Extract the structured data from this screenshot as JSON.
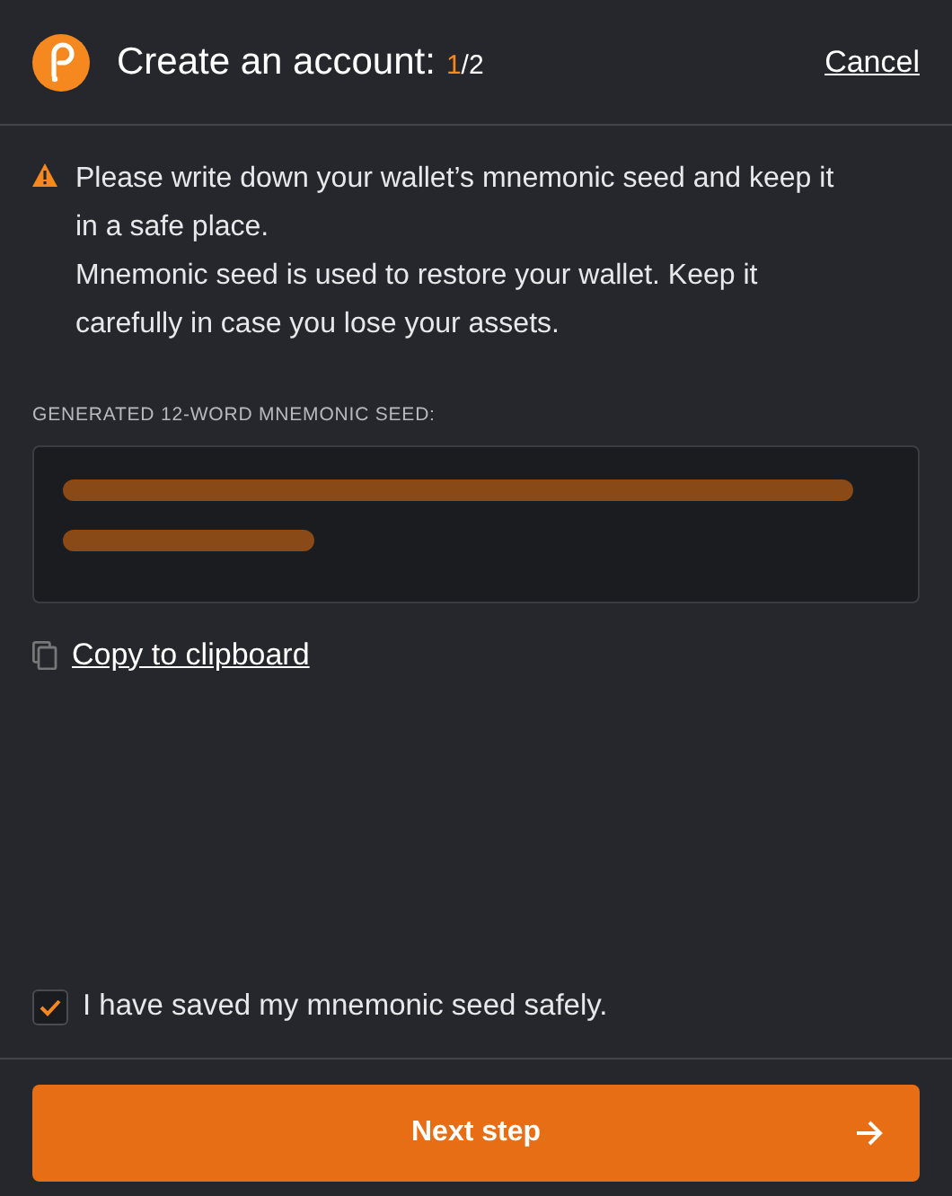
{
  "header": {
    "title": "Create an account:",
    "step_current": "1",
    "step_total": "/2",
    "cancel": "Cancel"
  },
  "warning": [
    "Please write down your wallet’s mnemonic seed and keep it in a safe place.",
    "Mnemonic seed is used to restore your wallet. Keep it carefully in case you lose your assets."
  ],
  "seed": {
    "label": "GENERATED 12-WORD MNEMONIC SEED:"
  },
  "copy_link": "Copy to clipboard",
  "confirm": {
    "label": "I have saved my mnemonic seed safely.",
    "checked": true
  },
  "next_button": "Next step"
}
